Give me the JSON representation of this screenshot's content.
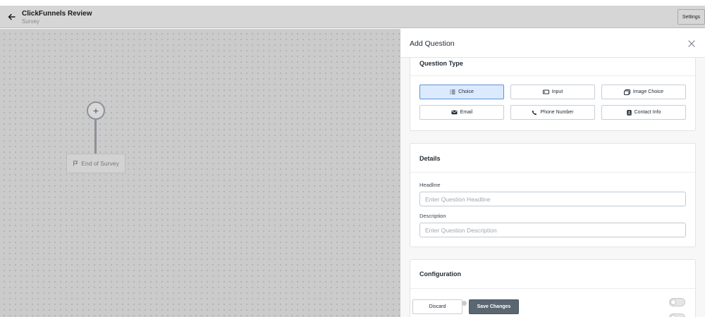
{
  "header": {
    "back_icon": "arrow-left-icon",
    "title": "ClickFunnels Review",
    "subtitle": "Survey",
    "settings_label": "Settings"
  },
  "canvas": {
    "add_node_label": "+",
    "end_node_label": "End of Survey",
    "end_node_icon": "flag-icon"
  },
  "panel": {
    "title": "Add Question",
    "close_icon": "close-icon",
    "question_type": {
      "title": "Question Type",
      "options": [
        {
          "label": "Choice",
          "icon": "list-icon",
          "selected": true
        },
        {
          "label": "Input",
          "icon": "input-icon",
          "selected": false
        },
        {
          "label": "Image Choice",
          "icon": "image-icon",
          "selected": false
        },
        {
          "label": "Email",
          "icon": "email-icon",
          "selected": false
        },
        {
          "label": "Phone Number",
          "icon": "phone-icon",
          "selected": false
        },
        {
          "label": "Contact Info",
          "icon": "contact-card-icon",
          "selected": false
        }
      ]
    },
    "details": {
      "title": "Details",
      "headline_label": "Headline",
      "headline_placeholder": "Enter Question Headline",
      "description_label": "Description",
      "description_placeholder": "Enter Question Description"
    },
    "configuration": {
      "title": "Configuration"
    },
    "footer": {
      "discard_label": "Discard",
      "save_label": "Save Changes"
    }
  },
  "colors": {
    "accent": "#5b93d6",
    "selected_bg": "#dbeafe",
    "save_button": "#5a6670",
    "canvas_bg": "#cbcbcb"
  }
}
